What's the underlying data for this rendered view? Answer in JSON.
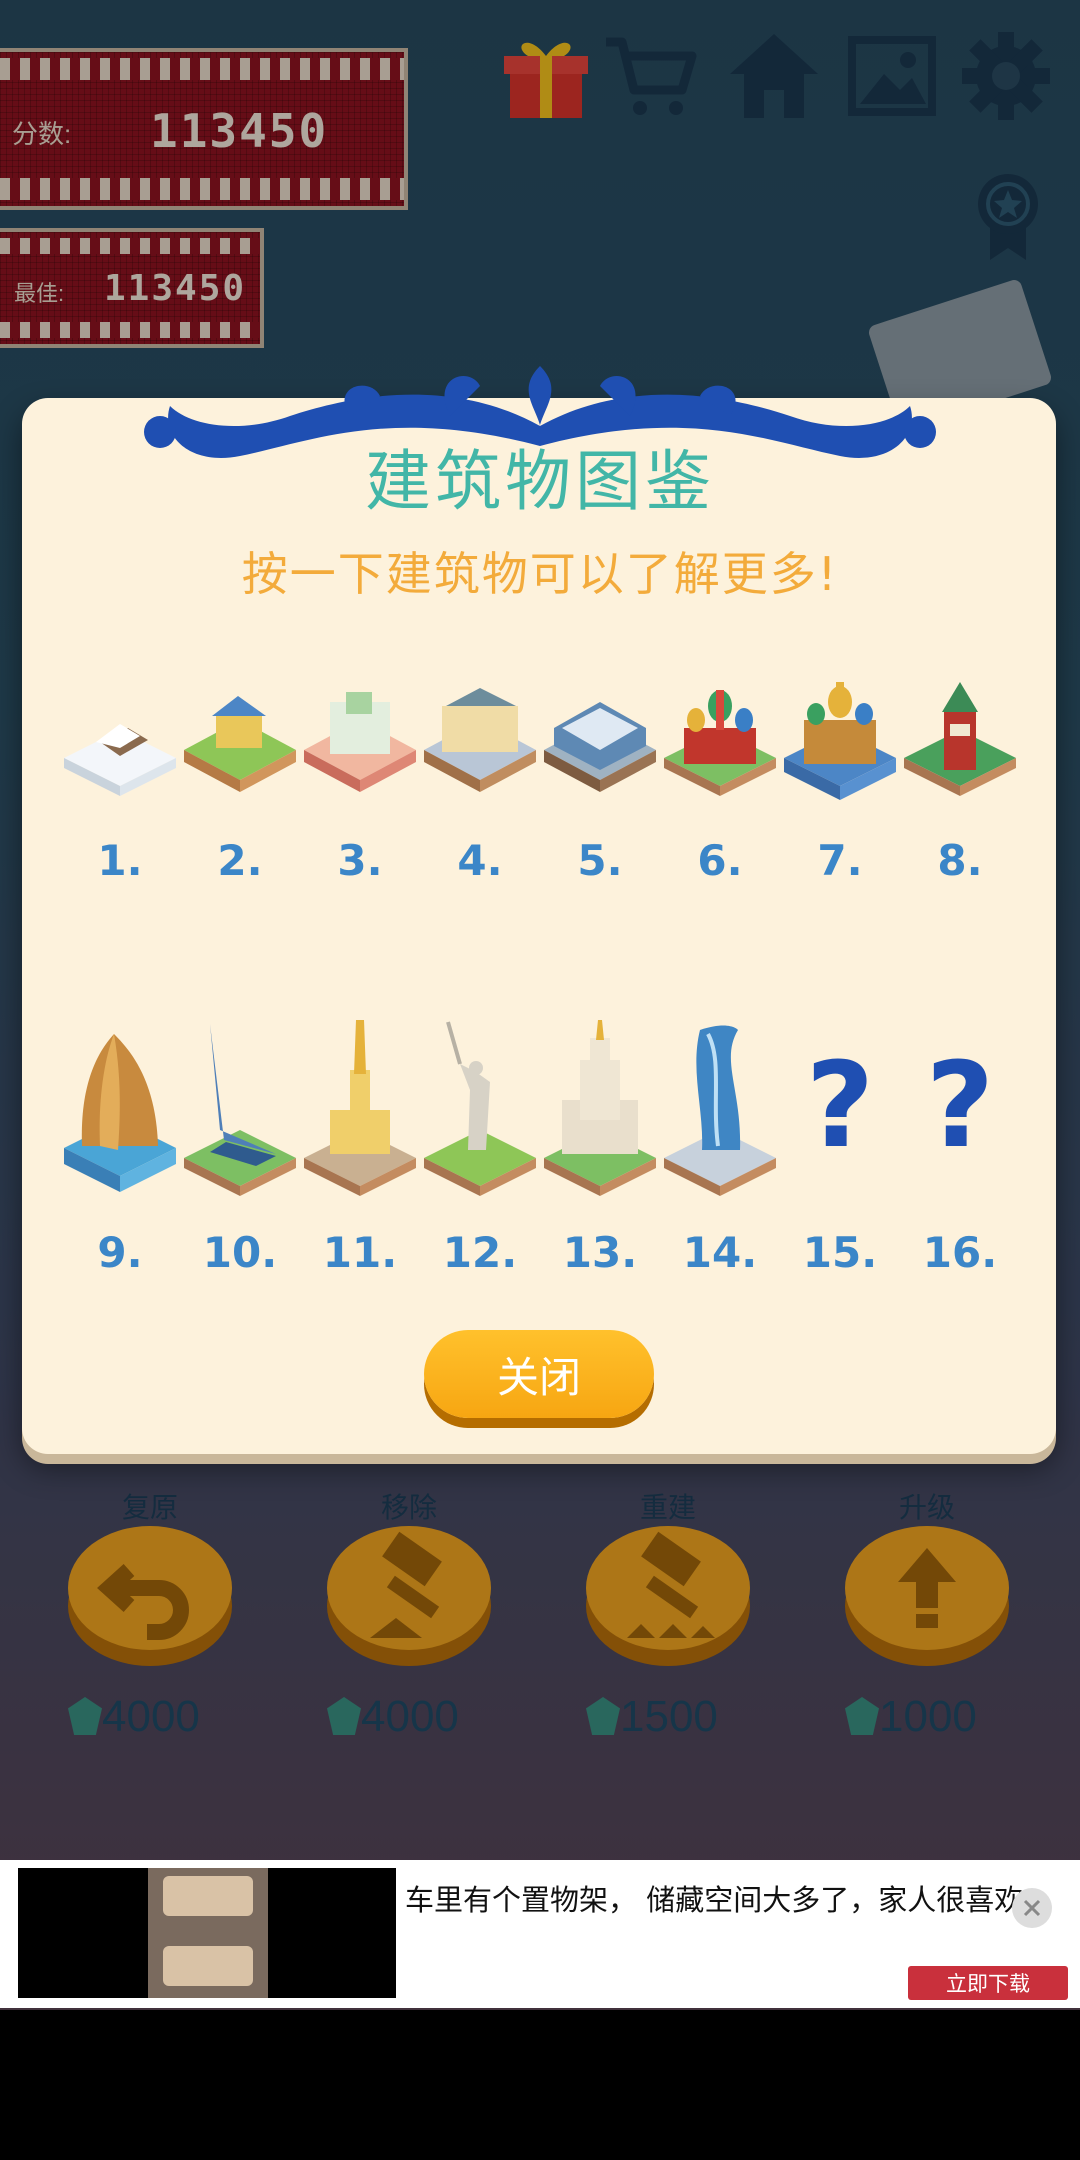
{
  "hud": {
    "score_label": "分数:",
    "score_value": "113450",
    "best_label": "最佳:",
    "best_value": "113450",
    "icons": [
      "gift-icon",
      "cart-icon",
      "home-icon",
      "gallery-icon",
      "gear-icon",
      "badge-icon"
    ]
  },
  "dialog": {
    "title": "建筑物图鉴",
    "subtitle": "按一下建筑物可以了解更多!",
    "buildings": [
      {
        "num": "1.",
        "name": "snow-cabin",
        "unlocked": true
      },
      {
        "num": "2.",
        "name": "yellow-house",
        "unlocked": true
      },
      {
        "num": "3.",
        "name": "mansion",
        "unlocked": true
      },
      {
        "num": "4.",
        "name": "theatre",
        "unlocked": true
      },
      {
        "num": "5.",
        "name": "glass-mall",
        "unlocked": true
      },
      {
        "num": "6.",
        "name": "st-basils-cathedral",
        "unlocked": true
      },
      {
        "num": "7.",
        "name": "church-of-savior-on-blood",
        "unlocked": true
      },
      {
        "num": "8.",
        "name": "kremlin-tower",
        "unlocked": true
      },
      {
        "num": "9.",
        "name": "rock-pillar",
        "unlocked": true
      },
      {
        "num": "10.",
        "name": "space-monument",
        "unlocked": true
      },
      {
        "num": "11.",
        "name": "peter-paul-cathedral",
        "unlocked": true
      },
      {
        "num": "12.",
        "name": "motherland-statue",
        "unlocked": true
      },
      {
        "num": "13.",
        "name": "moscow-state-university",
        "unlocked": true
      },
      {
        "num": "14.",
        "name": "evolution-tower",
        "unlocked": true
      },
      {
        "num": "15.",
        "name": "unknown",
        "unlocked": false,
        "glyph": "?"
      },
      {
        "num": "16.",
        "name": "unknown",
        "unlocked": false,
        "glyph": "?"
      }
    ],
    "close_label": "关闭"
  },
  "tools": [
    {
      "label": "复原",
      "cost": "4000",
      "icon": "undo-icon"
    },
    {
      "label": "移除",
      "cost": "4000",
      "icon": "hammer-icon"
    },
    {
      "label": "重建",
      "cost": "1500",
      "icon": "rebuild-icon"
    },
    {
      "label": "升级",
      "cost": "1000",
      "icon": "upgrade-arrow-icon"
    }
  ],
  "ad": {
    "text": "车里有个置物架， 储藏空间大多了，家人很喜欢",
    "cta": "立即下载"
  },
  "colors": {
    "title": "#42b6a7",
    "subtitle": "#f3ab3b",
    "number": "#3b86c8",
    "button": "#ffc12c",
    "board": "#8e1320"
  }
}
